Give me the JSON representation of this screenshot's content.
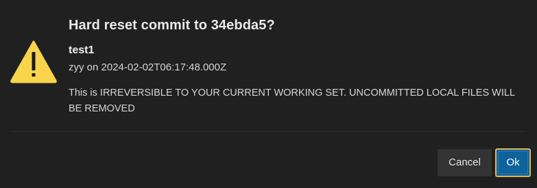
{
  "dialog": {
    "title": "Hard reset commit to 34ebda5?",
    "commit": {
      "name": "test1",
      "meta": "zyy on 2024-02-02T06:17:48.000Z"
    },
    "message": "This is IRREVERSIBLE TO YOUR CURRENT WORKING SET. UNCOMMITTED LOCAL FILES WILL BE REMOVED",
    "icon": "warning-triangle-icon",
    "buttons": {
      "cancel_label": "Cancel",
      "ok_label": "Ok"
    }
  },
  "colors": {
    "background": "#202020",
    "warning_fill": "#f7d44c",
    "primary_button": "#0e639c",
    "secondary_button": "#333333",
    "focus_ring": "#e2b75a"
  }
}
